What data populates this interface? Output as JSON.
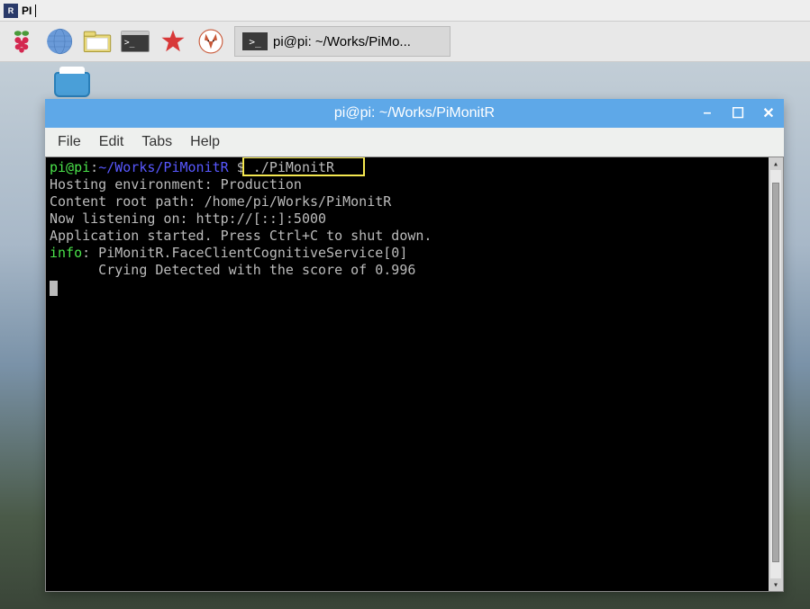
{
  "top_bar": {
    "icon_label": "R",
    "title": "PI"
  },
  "taskbar": {
    "app_item": {
      "prompt": ">_",
      "label": "pi@pi: ~/Works/PiMo..."
    }
  },
  "terminal": {
    "title": "pi@pi: ~/Works/PiMonitR",
    "menu": {
      "file": "File",
      "edit": "Edit",
      "tabs": "Tabs",
      "help": "Help"
    },
    "prompt": {
      "userhost": "pi@pi",
      "colon": ":",
      "path": "~/Works/PiMonitR",
      "dollar": " $ ",
      "command": "./PiMonitR"
    },
    "lines": {
      "l1": "Hosting environment: Production",
      "l2": "Content root path: /home/pi/Works/PiMonitR",
      "l3": "Now listening on: http://[::]:5000",
      "l4": "Application started. Press Ctrl+C to shut down.",
      "l5_prefix": "info",
      "l5_rest": ": PiMonitR.FaceClientCognitiveService[0]",
      "l6": "      Crying Detected with the score of 0.996"
    },
    "controls": {
      "minimize": "–",
      "maximize": "☐",
      "close": "✕"
    }
  }
}
